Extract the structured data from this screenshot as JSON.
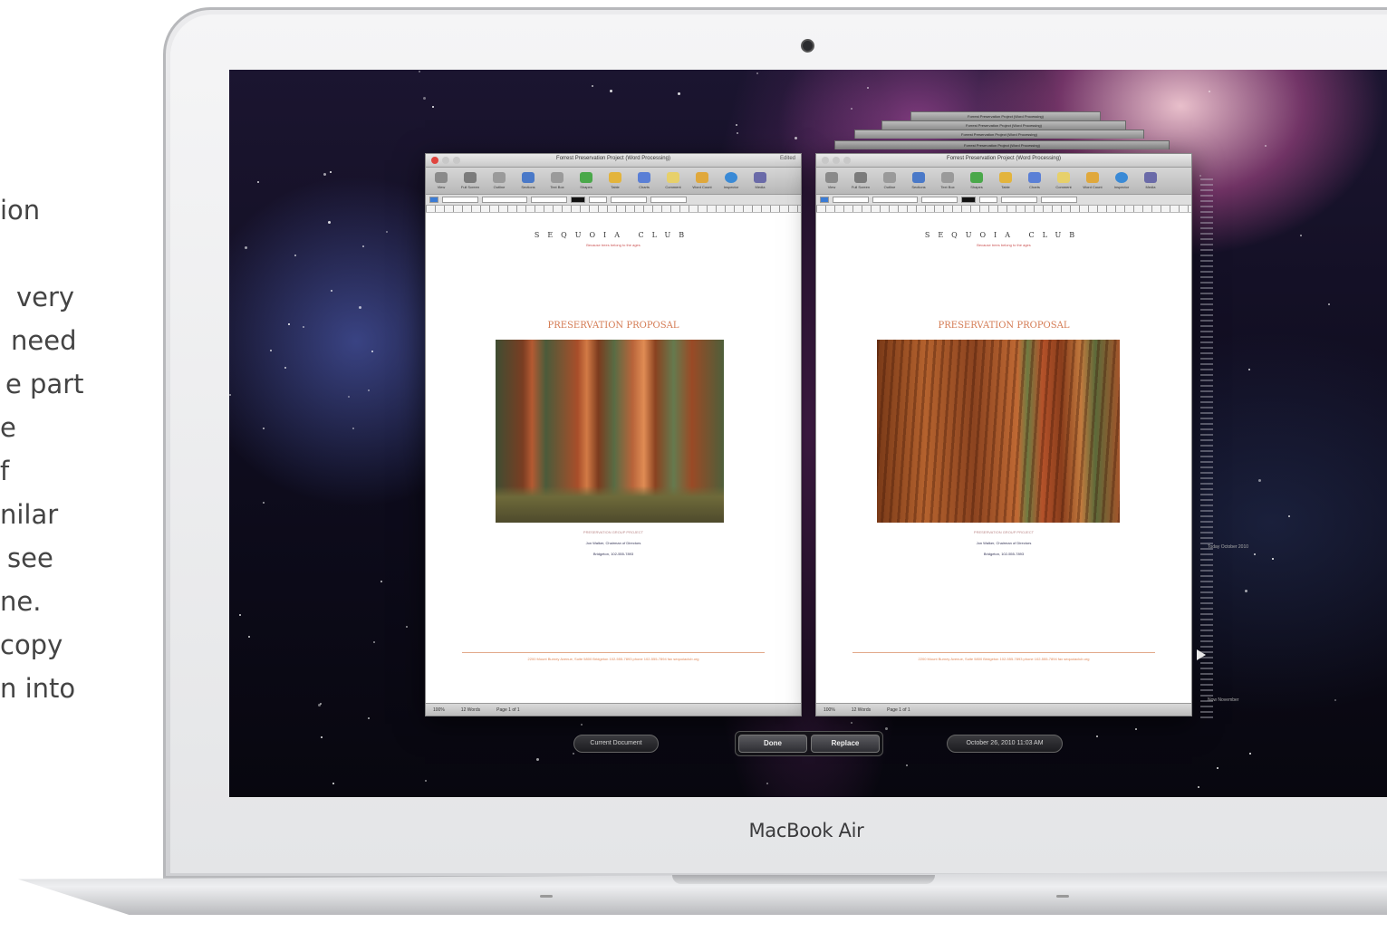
{
  "side_text": {
    "lines": [
      "ion",
      "very",
      " need",
      "e part",
      "e",
      "f",
      "nilar",
      "see",
      "ne.",
      "copy",
      "n into"
    ]
  },
  "laptop": {
    "brand": "MacBook Air"
  },
  "left_window": {
    "title": "Forrest Preservation Project (Word Processing)",
    "edited": "Edited",
    "club_name": "SEQUOIA CLUB",
    "club_subtitle": "Because trees belong to the ages",
    "heading": "PRESERVATION PROPOSAL",
    "caption_title": "PRESERVATION GROUP PROJECT",
    "caption_line2": "Jon Walker, Chairman of Directors",
    "caption_line3": "Bridgeton, 102-555-7893",
    "footer": "2200 Mount Burney Avenue, Suite 5800 Bridgeton  102-555-7893 phone  102-555-7894 fax  sequoiaclub.org",
    "status": [
      "100%",
      "12 Words",
      "Page 1 of 1"
    ]
  },
  "right_window": {
    "title": "Forrest Preservation Project (Word Processing)",
    "club_name": "SEQUOIA CLUB",
    "club_subtitle": "Because trees belong to the ages",
    "heading": "PRESERVATION PROPOSAL",
    "caption_title": "PRESERVATION GROUP PROJECT",
    "caption_line2": "Jon Walker, Chairman of Directors",
    "caption_line3": "Bridgeton, 102-555-7893",
    "footer": "2200 Mount Burney Avenue, Suite 5800 Bridgeton  102-555-7893 phone  102-555-7894 fax  sequoiaclub.org",
    "status": [
      "100%",
      "12 Words",
      "Page 1 of 1"
    ],
    "stack_titles": [
      "Forrest Preservation Project (Word Processing)",
      "Forrest Preservation Project (Word Processing)",
      "Forrest Preservation Project (Word Processing)",
      "Forrest Preservation Project (Word Processing)"
    ]
  },
  "toolbar_items": [
    "View",
    "Full Screen",
    "Outline",
    "Sections",
    "Text Box",
    "Shapes",
    "Table",
    "Charts",
    "Comment",
    "Word Count",
    "Inspector",
    "Media"
  ],
  "bottom_bar": {
    "current_document": "Current Document",
    "done": "Done",
    "replace": "Replace",
    "date": "October 26, 2010 11:03 AM"
  },
  "timeline": {
    "label_top": "Today  October 2010",
    "label_bottom": "Now  November"
  },
  "colors": {
    "accent_text": "#d47a52",
    "photo_tone": "#b45a32"
  }
}
